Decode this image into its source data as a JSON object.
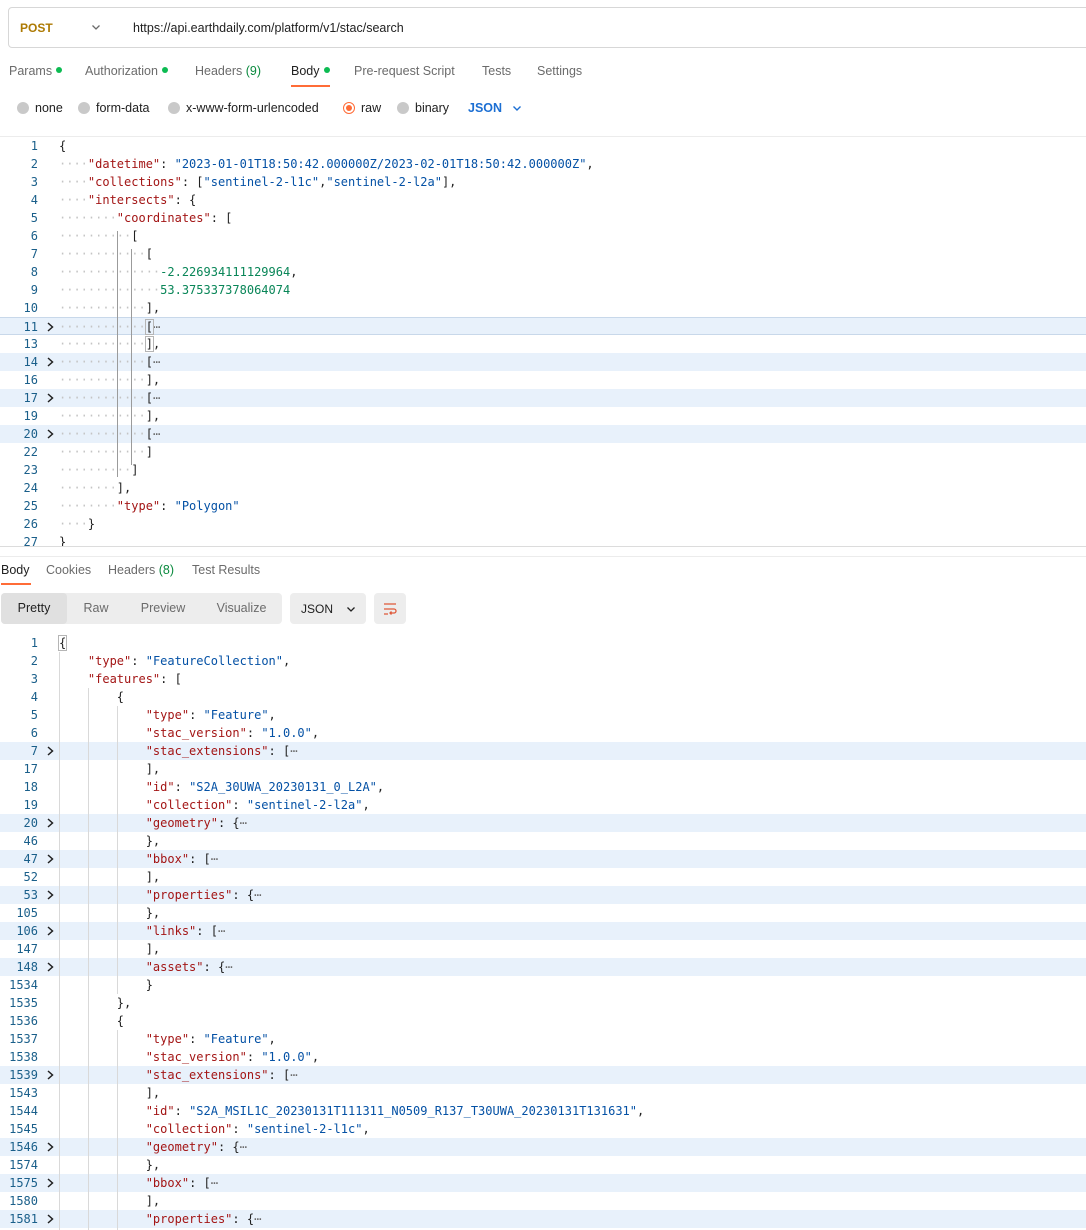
{
  "request": {
    "method": "POST",
    "url": "https://api.earthdaily.com/platform/v1/stac/search"
  },
  "request_tabs": [
    {
      "label": "Params",
      "dot": true
    },
    {
      "label": "Authorization",
      "dot": true
    },
    {
      "label": "Headers",
      "count": "(9)"
    },
    {
      "label": "Body",
      "dot": true,
      "active": true
    },
    {
      "label": "Pre-request Script"
    },
    {
      "label": "Tests"
    },
    {
      "label": "Settings"
    }
  ],
  "body_types": [
    {
      "label": "none"
    },
    {
      "label": "form-data"
    },
    {
      "label": "x-www-form-urlencoded"
    },
    {
      "label": "raw",
      "selected": true
    },
    {
      "label": "binary"
    }
  ],
  "body_format": "JSON",
  "request_lines": [
    {
      "n": "1",
      "fold": false,
      "indent": "",
      "html": "<span class='p'>{</span>"
    },
    {
      "n": "2",
      "fold": false,
      "indent": "····",
      "html": "<span class='k'>\"datetime\"</span><span class='p'>: </span><span class='s'>\"2023-01-01T18:50:42.000000Z/2023-02-01T18:50:42.000000Z\"</span><span class='p'>,</span>"
    },
    {
      "n": "3",
      "fold": false,
      "indent": "····",
      "html": "<span class='k'>\"collections\"</span><span class='p'>: [</span><span class='s'>\"sentinel-2-l1c\"</span><span class='p'>,</span><span class='s'>\"sentinel-2-l2a\"</span><span class='p'>],</span>"
    },
    {
      "n": "4",
      "fold": false,
      "indent": "····",
      "html": "<span class='k'>\"intersects\"</span><span class='p'>: {</span>"
    },
    {
      "n": "5",
      "fold": false,
      "indent": "········",
      "html": "<span class='k'>\"coordinates\"</span><span class='p'>: [</span>"
    },
    {
      "n": "6",
      "fold": false,
      "indent": "··········",
      "html": "<span class='p'>[</span>"
    },
    {
      "n": "7",
      "fold": false,
      "indent": "············",
      "html": "<span class='p'>[</span>"
    },
    {
      "n": "8",
      "fold": false,
      "indent": "··············",
      "html": "<span class='n'>-2.226934111129964</span><span class='p'>,</span>"
    },
    {
      "n": "9",
      "fold": false,
      "indent": "··············",
      "html": "<span class='n'>53.375337378064074</span>"
    },
    {
      "n": "10",
      "fold": false,
      "indent": "············",
      "html": "<span class='p'>],</span>"
    },
    {
      "n": "11",
      "fold": true,
      "sel": true,
      "indent": "············",
      "html": "<span class='p bracket-box'>[</span><span class='ell'>⋯</span>"
    },
    {
      "n": "13",
      "fold": false,
      "indent": "············",
      "html": "<span class='p bracket-box'>]</span><span class='p'>,</span>"
    },
    {
      "n": "14",
      "fold": true,
      "hl": true,
      "indent": "············",
      "html": "<span class='p'>[</span><span class='ell'>⋯</span>"
    },
    {
      "n": "16",
      "fold": false,
      "indent": "············",
      "html": "<span class='p'>],</span>"
    },
    {
      "n": "17",
      "fold": true,
      "hl": true,
      "indent": "············",
      "html": "<span class='p'>[</span><span class='ell'>⋯</span>"
    },
    {
      "n": "19",
      "fold": false,
      "indent": "············",
      "html": "<span class='p'>],</span>"
    },
    {
      "n": "20",
      "fold": true,
      "hl": true,
      "indent": "············",
      "html": "<span class='p'>[</span><span class='ell'>⋯</span>"
    },
    {
      "n": "22",
      "fold": false,
      "indent": "············",
      "html": "<span class='p'>]</span>"
    },
    {
      "n": "23",
      "fold": false,
      "indent": "··········",
      "html": "<span class='p'>]</span>"
    },
    {
      "n": "24",
      "fold": false,
      "indent": "········",
      "html": "<span class='p'>],</span>"
    },
    {
      "n": "25",
      "fold": false,
      "indent": "········",
      "html": "<span class='k'>\"type\"</span><span class='p'>: </span><span class='s'>\"Polygon\"</span>"
    },
    {
      "n": "26",
      "fold": false,
      "indent": "····",
      "html": "<span class='p'>}</span>"
    },
    {
      "n": "27",
      "fold": false,
      "indent": "",
      "html": "<span class='p'>}</span>"
    }
  ],
  "response_tabs": [
    {
      "label": "Body",
      "active": true
    },
    {
      "label": "Cookies"
    },
    {
      "label": "Headers",
      "count": "(8)"
    },
    {
      "label": "Test Results"
    }
  ],
  "view_modes": [
    "Pretty",
    "Raw",
    "Preview",
    "Visualize"
  ],
  "response_format": "JSON",
  "response_lines": [
    {
      "n": "1",
      "fold": false,
      "indent": 0,
      "html": "<span class='p bracket-box'>{</span>"
    },
    {
      "n": "2",
      "fold": false,
      "indent": 1,
      "html": "<span class='k'>\"type\"</span><span class='p'>: </span><span class='s'>\"FeatureCollection\"</span><span class='p'>,</span>"
    },
    {
      "n": "3",
      "fold": false,
      "indent": 1,
      "html": "<span class='k'>\"features\"</span><span class='p'>: [</span>"
    },
    {
      "n": "4",
      "fold": false,
      "indent": 2,
      "html": "<span class='p'>{</span>"
    },
    {
      "n": "5",
      "fold": false,
      "indent": 3,
      "html": "<span class='k'>\"type\"</span><span class='p'>: </span><span class='s'>\"Feature\"</span><span class='p'>,</span>"
    },
    {
      "n": "6",
      "fold": false,
      "indent": 3,
      "html": "<span class='k'>\"stac_version\"</span><span class='p'>: </span><span class='s'>\"1.0.0\"</span><span class='p'>,</span>"
    },
    {
      "n": "7",
      "fold": true,
      "hl": true,
      "indent": 3,
      "html": "<span class='k'>\"stac_extensions\"</span><span class='p'>: [</span><span class='ell'>⋯</span>"
    },
    {
      "n": "17",
      "fold": false,
      "indent": 3,
      "html": "<span class='p'>],</span>"
    },
    {
      "n": "18",
      "fold": false,
      "indent": 3,
      "html": "<span class='k'>\"id\"</span><span class='p'>: </span><span class='s'>\"S2A_30UWA_20230131_0_L2A\"</span><span class='p'>,</span>"
    },
    {
      "n": "19",
      "fold": false,
      "indent": 3,
      "html": "<span class='k'>\"collection\"</span><span class='p'>: </span><span class='s'>\"sentinel-2-l2a\"</span><span class='p'>,</span>"
    },
    {
      "n": "20",
      "fold": true,
      "hl": true,
      "indent": 3,
      "html": "<span class='k'>\"geometry\"</span><span class='p'>: {</span><span class='ell'>⋯</span>"
    },
    {
      "n": "46",
      "fold": false,
      "indent": 3,
      "html": "<span class='p'>},</span>"
    },
    {
      "n": "47",
      "fold": true,
      "hl": true,
      "indent": 3,
      "html": "<span class='k'>\"bbox\"</span><span class='p'>: [</span><span class='ell'>⋯</span>"
    },
    {
      "n": "52",
      "fold": false,
      "indent": 3,
      "html": "<span class='p'>],</span>"
    },
    {
      "n": "53",
      "fold": true,
      "hl": true,
      "indent": 3,
      "html": "<span class='k'>\"properties\"</span><span class='p'>: {</span><span class='ell'>⋯</span>"
    },
    {
      "n": "105",
      "fold": false,
      "indent": 3,
      "html": "<span class='p'>},</span>"
    },
    {
      "n": "106",
      "fold": true,
      "hl": true,
      "indent": 3,
      "html": "<span class='k'>\"links\"</span><span class='p'>: [</span><span class='ell'>⋯</span>"
    },
    {
      "n": "147",
      "fold": false,
      "indent": 3,
      "html": "<span class='p'>],</span>"
    },
    {
      "n": "148",
      "fold": true,
      "hl": true,
      "indent": 3,
      "html": "<span class='k'>\"assets\"</span><span class='p'>: {</span><span class='ell'>⋯</span>"
    },
    {
      "n": "1534",
      "fold": false,
      "indent": 3,
      "html": "<span class='p'>}</span>"
    },
    {
      "n": "1535",
      "fold": false,
      "indent": 2,
      "html": "<span class='p'>},</span>"
    },
    {
      "n": "1536",
      "fold": false,
      "indent": 2,
      "html": "<span class='p'>{</span>"
    },
    {
      "n": "1537",
      "fold": false,
      "indent": 3,
      "html": "<span class='k'>\"type\"</span><span class='p'>: </span><span class='s'>\"Feature\"</span><span class='p'>,</span>"
    },
    {
      "n": "1538",
      "fold": false,
      "indent": 3,
      "html": "<span class='k'>\"stac_version\"</span><span class='p'>: </span><span class='s'>\"1.0.0\"</span><span class='p'>,</span>"
    },
    {
      "n": "1539",
      "fold": true,
      "hl": true,
      "indent": 3,
      "html": "<span class='k'>\"stac_extensions\"</span><span class='p'>: [</span><span class='ell'>⋯</span>"
    },
    {
      "n": "1543",
      "fold": false,
      "indent": 3,
      "html": "<span class='p'>],</span>"
    },
    {
      "n": "1544",
      "fold": false,
      "indent": 3,
      "html": "<span class='k'>\"id\"</span><span class='p'>: </span><span class='s'>\"S2A_MSIL1C_20230131T111311_N0509_R137_T30UWA_20230131T131631\"</span><span class='p'>,</span>"
    },
    {
      "n": "1545",
      "fold": false,
      "indent": 3,
      "html": "<span class='k'>\"collection\"</span><span class='p'>: </span><span class='s'>\"sentinel-2-l1c\"</span><span class='p'>,</span>"
    },
    {
      "n": "1546",
      "fold": true,
      "hl": true,
      "indent": 3,
      "html": "<span class='k'>\"geometry\"</span><span class='p'>: {</span><span class='ell'>⋯</span>"
    },
    {
      "n": "1574",
      "fold": false,
      "indent": 3,
      "html": "<span class='p'>},</span>"
    },
    {
      "n": "1575",
      "fold": true,
      "hl": true,
      "indent": 3,
      "html": "<span class='k'>\"bbox\"</span><span class='p'>: [</span><span class='ell'>⋯</span>"
    },
    {
      "n": "1580",
      "fold": false,
      "indent": 3,
      "html": "<span class='p'>],</span>"
    },
    {
      "n": "1581",
      "fold": true,
      "hl": true,
      "indent": 3,
      "html": "<span class='k'>\"properties\"</span><span class='p'>: {</span><span class='ell'>⋯</span>"
    }
  ],
  "colors": {
    "accent": "#ff6c37",
    "status_dot": "#0cbb52",
    "method": "#ad7a03",
    "json_key": "#a31515",
    "json_string": "#0451a5",
    "json_number": "#098658"
  }
}
